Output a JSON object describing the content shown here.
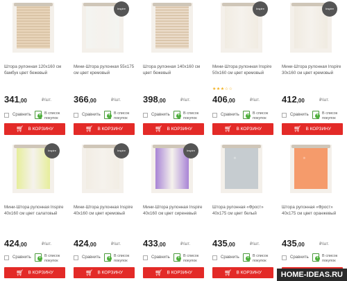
{
  "colors": {
    "accent": "#e32a27",
    "list_green": "#4caf3a",
    "rating": "#f2b01e"
  },
  "cart_label": "В КОРЗИНУ",
  "cart_icon": "cart-icon",
  "compare_label": "Сравнить",
  "list_label": "В список покупок",
  "currency_unit": "₽/шт.",
  "rows": [
    [
      {
        "title": "Штора рулонная 120х160 см бамбук цвет бежевый",
        "price": "341",
        "cents": ",00",
        "rating": "",
        "badge": "",
        "color": "#e7d3b8",
        "pattern": "bamboo"
      },
      {
        "title": "Мини-Штора рулонная 55х175 см цвет кремовый",
        "price": "366",
        "cents": ",00",
        "rating": "",
        "badge": "Inspire",
        "color": "#f3f4f1",
        "pattern": "plain"
      },
      {
        "title": "Штора рулонная 140х160 см цвет бежевый",
        "price": "398",
        "cents": ",00",
        "rating": "",
        "badge": "",
        "color": "#e9d9c6",
        "pattern": "bamboo"
      },
      {
        "title": "Мини-Штора рулонная Inspire 50х160 см цвет кремовый",
        "price": "406",
        "cents": ",00",
        "rating": "★★★☆☆",
        "badge": "Inspire",
        "color": "#f1ece2",
        "pattern": "plain"
      },
      {
        "title": "Мини-Штора рулонная Inspire 30х160 см цвет кремовый",
        "price": "412",
        "cents": ",00",
        "rating": "",
        "badge": "Inspire",
        "color": "#f0ebe1",
        "pattern": "plain"
      }
    ],
    [
      {
        "title": "Мини-Штора рулонная Inspire 40х160 см цвет салатовый",
        "price": "424",
        "cents": ",00",
        "rating": "",
        "badge": "Inspire",
        "color": "#e6ee9a",
        "pattern": "plain"
      },
      {
        "title": "Мини-Штора рулонная Inspire 40х160 см цвет кремовый",
        "price": "424",
        "cents": ",00",
        "rating": "",
        "badge": "Inspire",
        "color": "#f2ede4",
        "pattern": "plain"
      },
      {
        "title": "Мини-Штора рулонная Inspire 40х160 см цвет сиреневый",
        "price": "433",
        "cents": ",00",
        "rating": "",
        "badge": "Inspire",
        "color": "#a884d6",
        "pattern": "plain"
      },
      {
        "title": "Штора рулонная «Фрост» 40х175 см цвет белый",
        "price": "435",
        "cents": ",00",
        "rating": "",
        "badge": "",
        "color": "#c6ccd0",
        "pattern": "frost"
      },
      {
        "title": "Штора рулонная «Фрост» 40х175 см цвет оранжевый",
        "price": "435",
        "cents": ",00",
        "rating": "",
        "badge": "",
        "color": "#f59b6b",
        "pattern": "frost"
      }
    ]
  ],
  "watermark": "HOME-IDEAS.RU"
}
